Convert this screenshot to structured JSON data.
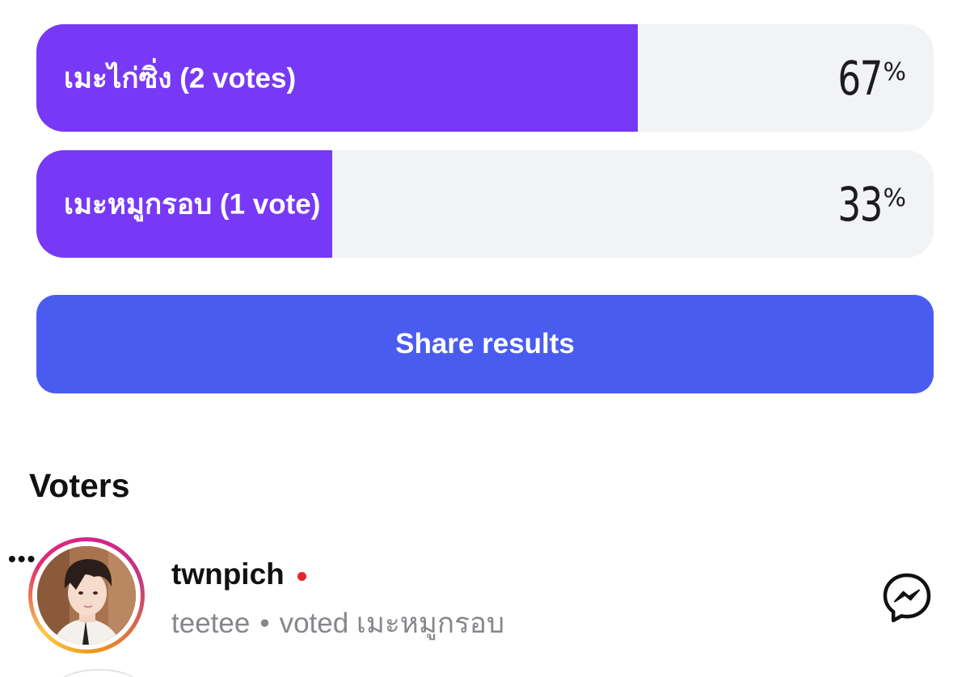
{
  "poll": {
    "options": [
      {
        "label": "เมะไก่ซิ่ง (2 votes)",
        "percent_value": 67,
        "percent_symbol": "%",
        "fill_percent": 67
      },
      {
        "label": "เมะหมูกรอบ (1 vote)",
        "percent_value": 33,
        "percent_symbol": "%",
        "fill_percent": 33
      }
    ],
    "share_label": "Share results"
  },
  "voters": {
    "title": "Voters",
    "list": [
      {
        "username": "twnpich",
        "display_name": "teetee",
        "separator": "•",
        "vote_text": "voted เมะหมูกรอบ"
      }
    ]
  },
  "colors": {
    "poll_fill": "#7739f5",
    "poll_track": "#f2f3f5",
    "share_button": "#4a5cf0",
    "status_dot": "#e8242f"
  },
  "icons": {
    "messenger": "messenger-icon",
    "more": "more-dots-icon"
  }
}
